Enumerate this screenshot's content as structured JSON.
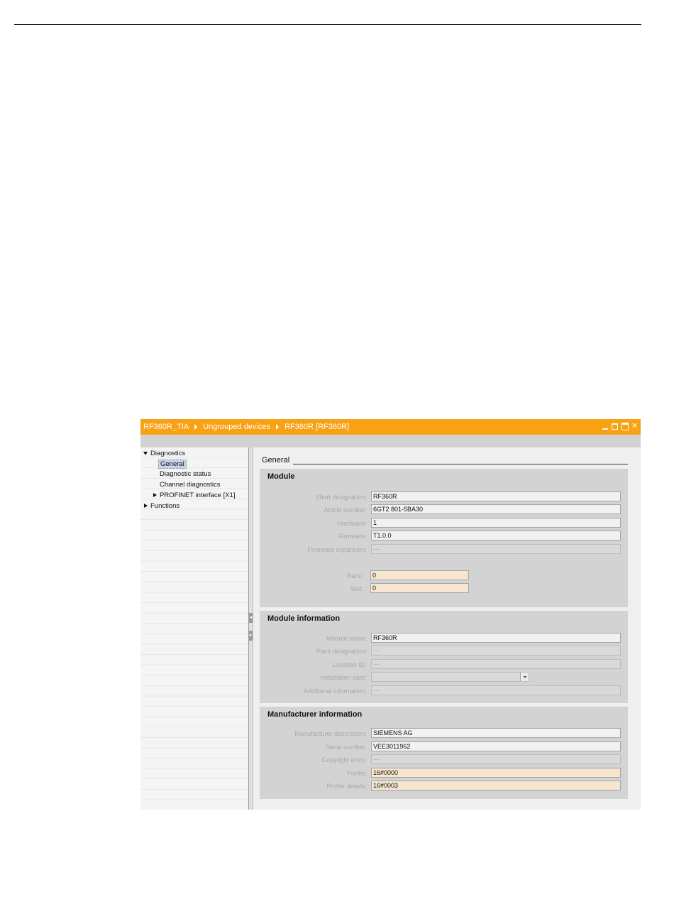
{
  "breadcrumb": [
    "RF360R_TIA",
    "Ungrouped devices",
    "RF360R [RF360R]"
  ],
  "window_controls": [
    "minimize-icon",
    "float-icon",
    "maximize-icon",
    "close-icon"
  ],
  "nav": {
    "diagnostics": "Diagnostics",
    "general": "General",
    "diagnostic_status": "Diagnostic status",
    "channel_diagnostics": "Channel diagnostics",
    "profinet_interface": "PROFINET interface [X1]",
    "functions": "Functions"
  },
  "content": {
    "heading": "General",
    "module": {
      "title": "Module",
      "short_designation": {
        "label": "Short designation:",
        "value": "RF360R"
      },
      "article_number": {
        "label": "Article number:",
        "value": "6GT2 801-5BA30"
      },
      "hardware": {
        "label": "Hardware:",
        "value": "1"
      },
      "firmware": {
        "label": "Firmware:",
        "value": "T1.0.0"
      },
      "firmware_expansion": {
        "label": "Firmware expansion:",
        "value": "---"
      },
      "rack": {
        "label": "Rack:",
        "value": "0"
      },
      "slot": {
        "label": "Slot:",
        "value": "0"
      }
    },
    "module_information": {
      "title": "Module information",
      "module_name": {
        "label": "Module name:",
        "value": "RF360R"
      },
      "plant_designation": {
        "label": "Plant designation:",
        "value": "---"
      },
      "location_id": {
        "label": "Location ID:",
        "value": "---"
      },
      "installation_date": {
        "label": "Installation date:",
        "value": ""
      },
      "additional_information": {
        "label": "Additional information:",
        "value": "---"
      }
    },
    "manufacturer_information": {
      "title": "Manufacturer information",
      "manufacturer_description": {
        "label": "Manufacturer description:",
        "value": "SIEMENS AG"
      },
      "serial_number": {
        "label": "Serial number:",
        "value": "VEE3011962"
      },
      "copyright_entry": {
        "label": "Copyright entry:",
        "value": "---"
      },
      "profile": {
        "label": "Profile:",
        "value": "16#0000"
      },
      "profile_details": {
        "label": "Profile details:",
        "value": "16#0003"
      }
    }
  },
  "colors": {
    "titlebar": "#f7a113",
    "section_background": "#d3d3d3",
    "readonly_field": "#f7e6cf",
    "selected_nav": "#c7d3e6"
  }
}
